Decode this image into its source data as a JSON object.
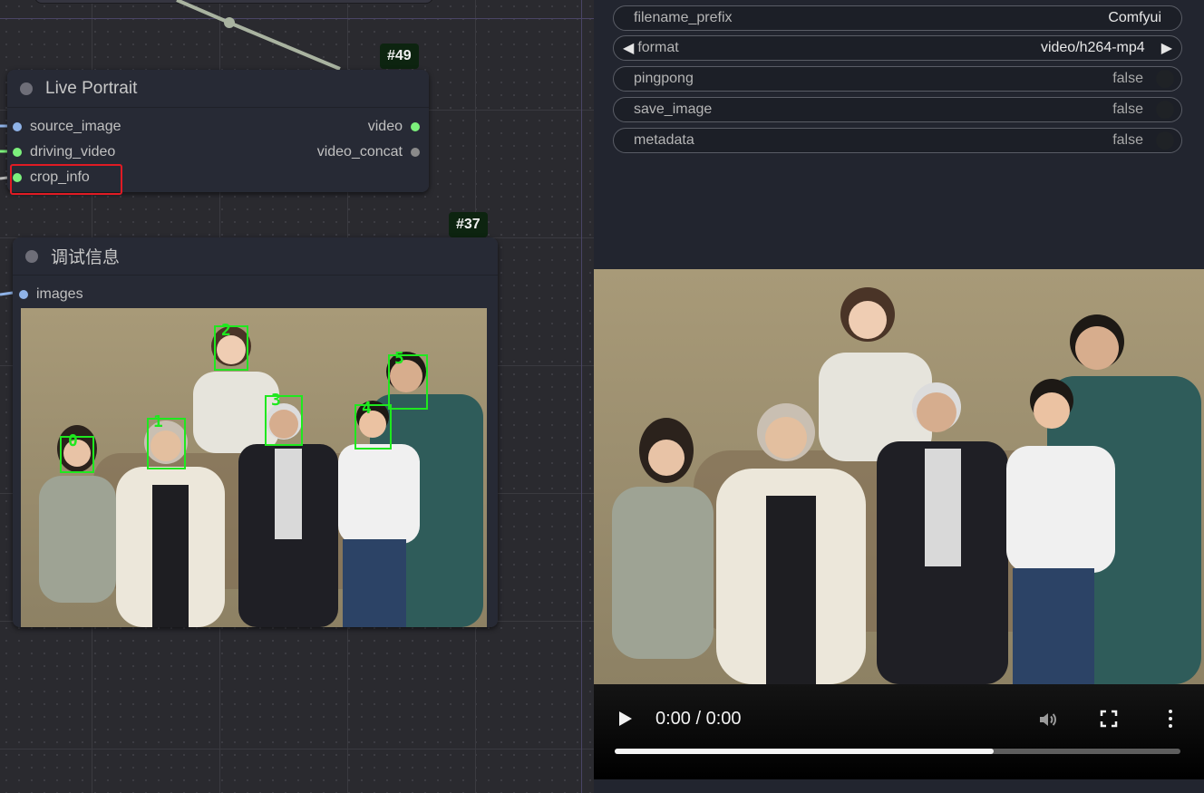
{
  "graph": {
    "node49": {
      "badge": "#49",
      "title": "Live Portrait",
      "inputs": [
        "source_image",
        "driving_video",
        "crop_info"
      ],
      "outputs": [
        "video",
        "video_concat"
      ]
    },
    "node37": {
      "badge": "#37",
      "title": "调试信息",
      "inputs": [
        "images"
      ],
      "face_labels": [
        "0",
        "1",
        "2",
        "3",
        "4",
        "5"
      ]
    }
  },
  "panel": {
    "widgets": [
      {
        "label": "filename_prefix",
        "value": "Comfyui",
        "kind": "text"
      },
      {
        "label": "format",
        "value": "video/h264-mp4",
        "kind": "combo"
      },
      {
        "label": "pingpong",
        "value": "false",
        "kind": "toggle"
      },
      {
        "label": "save_image",
        "value": "false",
        "kind": "toggle"
      },
      {
        "label": "metadata",
        "value": "false",
        "kind": "toggle"
      }
    ],
    "video": {
      "time": "0:00 / 0:00",
      "progress": 0.67
    }
  },
  "colors": {
    "slot_image": "#8fb3e8",
    "slot_green": "#7cf07c",
    "slot_gray": "#8a8a8a",
    "highlight": "#e01b24",
    "badge_bg": "#0d2410"
  }
}
